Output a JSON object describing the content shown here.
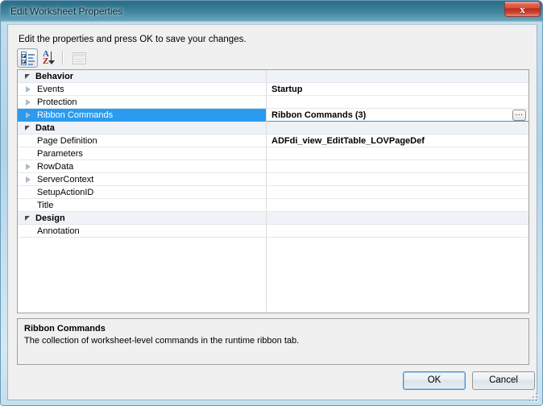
{
  "window": {
    "title": "Edit Worksheet Properties",
    "close_label": "x"
  },
  "content": {
    "instruction": "Edit the properties and press OK to save your changes."
  },
  "toolbar": {
    "buttons": [
      {
        "name": "categorized-view",
        "tooltip": "Categorized"
      },
      {
        "name": "alphabetical-sort",
        "tooltip": "Alphabetical"
      },
      {
        "name": "property-pages",
        "tooltip": "Property Pages"
      }
    ]
  },
  "grid": {
    "rows": [
      {
        "type": "category",
        "name": "Behavior",
        "value": "",
        "expanded": true
      },
      {
        "type": "property",
        "name": "Events",
        "value": "Startup",
        "expandable": true
      },
      {
        "type": "property",
        "name": "Protection",
        "value": "",
        "expandable": true
      },
      {
        "type": "property",
        "name": "Ribbon Commands",
        "value": "Ribbon Commands (3)",
        "expandable": true,
        "selected": true,
        "has_ellipsis": true,
        "ellipsis_label": "..."
      },
      {
        "type": "category",
        "name": "Data",
        "value": "",
        "expanded": true
      },
      {
        "type": "property",
        "name": "Page Definition",
        "value": "ADFdi_view_EditTable_LOVPageDef",
        "expandable": false
      },
      {
        "type": "property",
        "name": "Parameters",
        "value": "",
        "expandable": false
      },
      {
        "type": "property",
        "name": "RowData",
        "value": "",
        "expandable": true
      },
      {
        "type": "property",
        "name": "ServerContext",
        "value": "",
        "expandable": true
      },
      {
        "type": "property",
        "name": "SetupActionID",
        "value": "",
        "expandable": false
      },
      {
        "type": "property",
        "name": "Title",
        "value": "",
        "expandable": false
      },
      {
        "type": "category",
        "name": "Design",
        "value": "",
        "expanded": true
      },
      {
        "type": "property",
        "name": "Annotation",
        "value": "",
        "expandable": false
      }
    ]
  },
  "description": {
    "title": "Ribbon Commands",
    "text": "The collection of worksheet-level commands in the runtime ribbon tab."
  },
  "buttons": {
    "ok": "OK",
    "cancel": "Cancel"
  },
  "colors": {
    "selection": "#2a9bf0",
    "title_gradient_top": "#2e6c86",
    "close_button": "#cc4430",
    "category_row": "#eff3f7"
  }
}
